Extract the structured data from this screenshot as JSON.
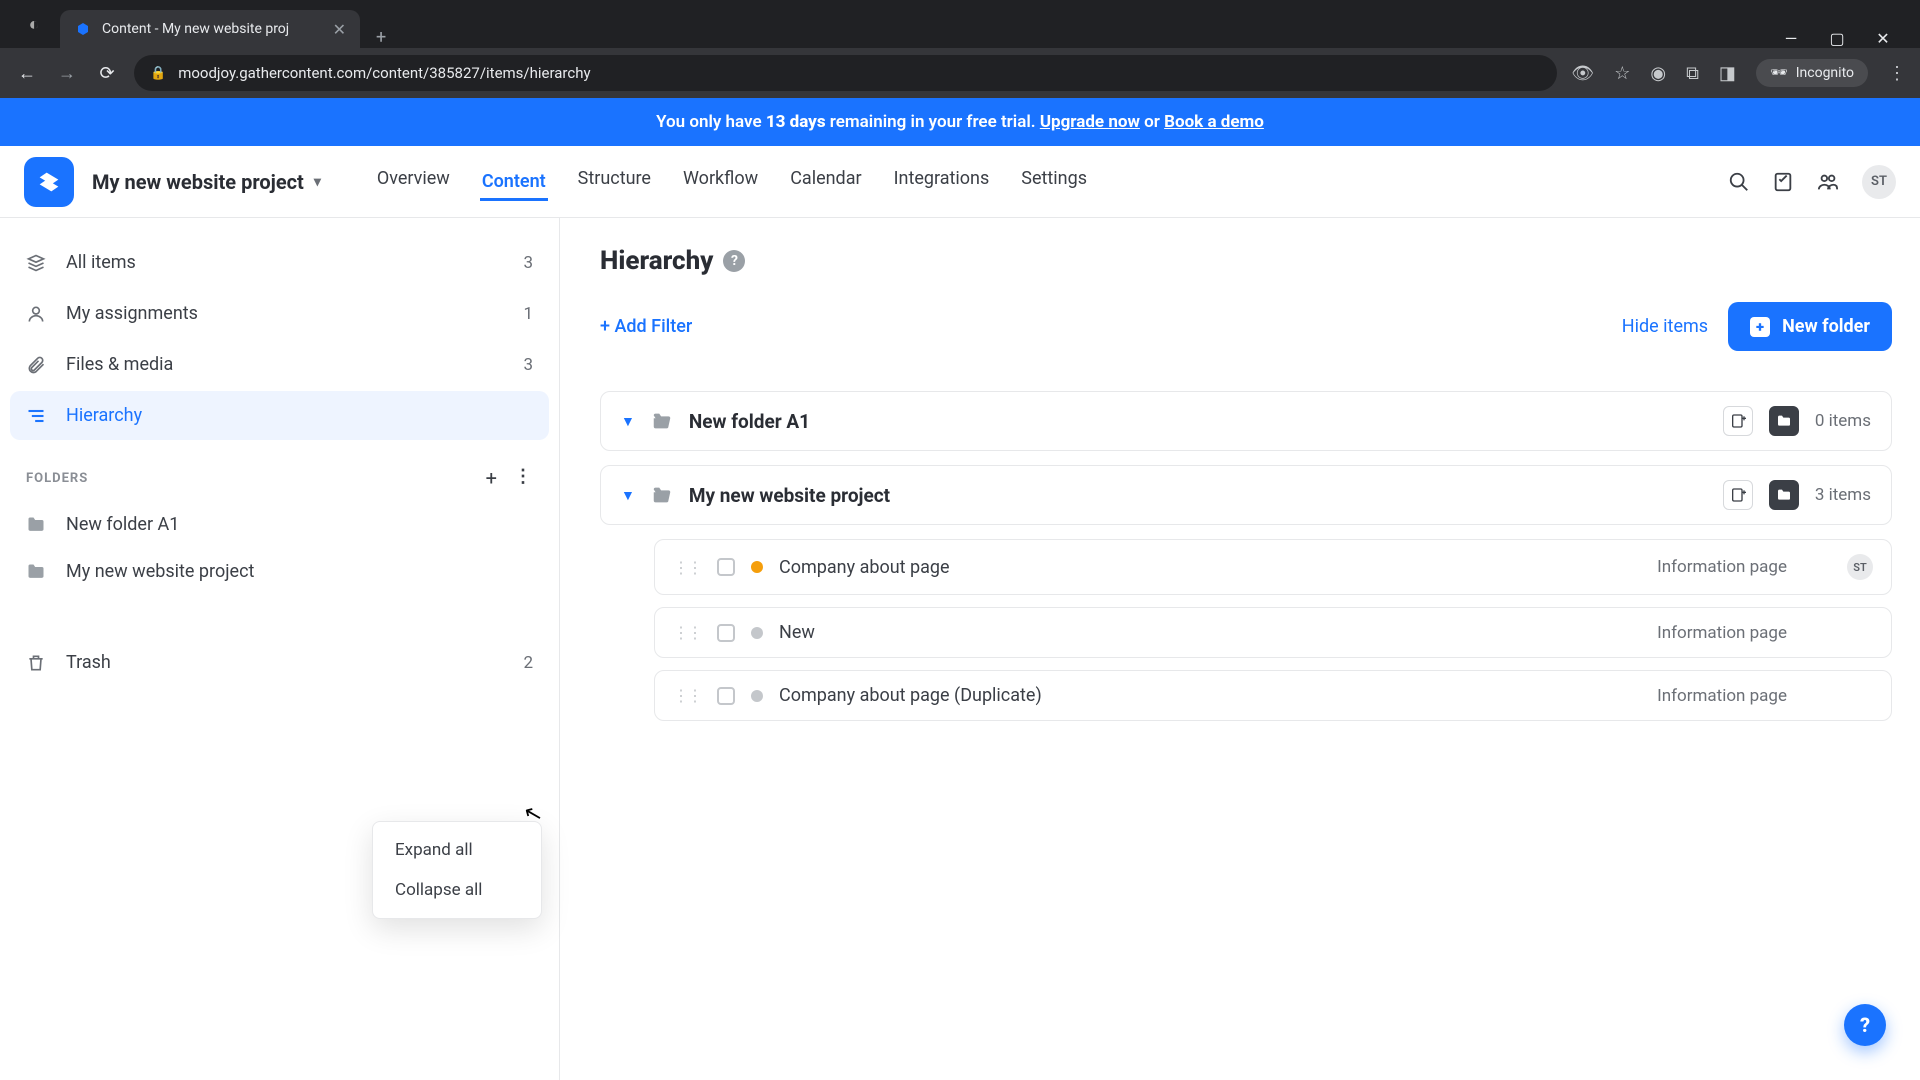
{
  "browser": {
    "tab_title": "Content - My new website proj",
    "url": "moodjoy.gathercontent.com/content/385827/items/hierarchy",
    "incognito_label": "Incognito"
  },
  "banner": {
    "prefix": "You only have ",
    "days": "13 days",
    "mid": " remaining in your free trial. ",
    "upgrade": "Upgrade now",
    "or": " or ",
    "demo": "Book a demo"
  },
  "header": {
    "project_name": "My new website project",
    "tabs": [
      "Overview",
      "Content",
      "Structure",
      "Workflow",
      "Calendar",
      "Integrations",
      "Settings"
    ],
    "active_tab": "Content",
    "avatar": "ST"
  },
  "sidebar": {
    "items": [
      {
        "label": "All items",
        "count": "3"
      },
      {
        "label": "My assignments",
        "count": "1"
      },
      {
        "label": "Files & media",
        "count": "3"
      },
      {
        "label": "Hierarchy",
        "count": ""
      }
    ],
    "folders_label": "FOLDERS",
    "folders": [
      {
        "label": "New folder A1"
      },
      {
        "label": "My new website project"
      }
    ],
    "trash_label": "Trash",
    "trash_count": "2",
    "context_menu": {
      "expand": "Expand all",
      "collapse": "Collapse all"
    }
  },
  "main": {
    "title": "Hierarchy",
    "add_filter": "+ Add Filter",
    "hide_items": "Hide items",
    "new_folder": "New folder",
    "folders": [
      {
        "name": "New folder A1",
        "count": "0 items",
        "children": []
      },
      {
        "name": "My new website project",
        "count": "3 items",
        "children": [
          {
            "name": "Company about page",
            "template": "Information page",
            "status": "orange",
            "assignee": "ST"
          },
          {
            "name": "New",
            "template": "Information page",
            "status": "grey",
            "assignee": ""
          },
          {
            "name": "Company about page (Duplicate)",
            "template": "Information page",
            "status": "grey",
            "assignee": ""
          }
        ]
      }
    ]
  }
}
